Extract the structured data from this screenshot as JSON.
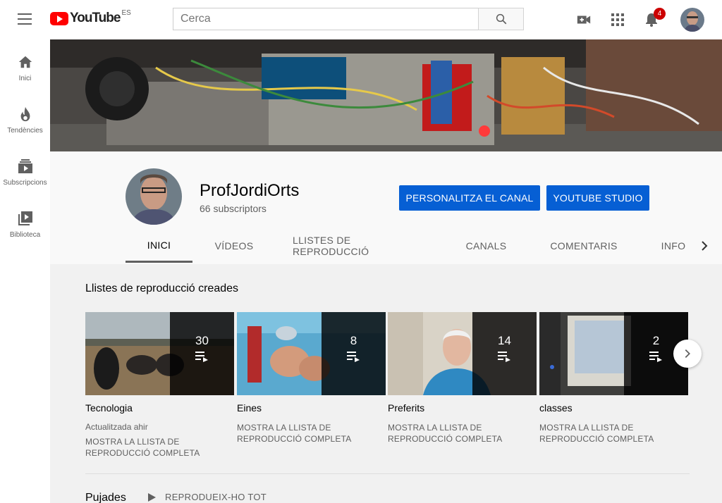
{
  "header": {
    "logo_text": "YouTube",
    "logo_region": "ES",
    "search_placeholder": "Cerca",
    "notification_count": "4"
  },
  "sidebar": {
    "items": [
      {
        "label": "Inici",
        "icon": "home-icon"
      },
      {
        "label": "Tendències",
        "icon": "trending-icon"
      },
      {
        "label": "Subscripcions",
        "icon": "subscriptions-icon"
      },
      {
        "label": "Biblioteca",
        "icon": "library-icon"
      }
    ]
  },
  "channel": {
    "name": "ProfJordiOrts",
    "subscribers": "66 subscriptors",
    "customize_label": "PERSONALITZA EL CANAL",
    "studio_label": "YOUTUBE STUDIO"
  },
  "tabs": [
    {
      "label": "INICI",
      "active": true
    },
    {
      "label": "VÍDEOS",
      "active": false
    },
    {
      "label": "LLISTES DE REPRODUCCIÓ",
      "active": false
    },
    {
      "label": "CANALS",
      "active": false
    },
    {
      "label": "COMENTARIS",
      "active": false
    },
    {
      "label": "INFO",
      "active": false
    }
  ],
  "playlists_section": {
    "title": "Llistes de reproducció creades",
    "items": [
      {
        "title": "Tecnologia",
        "count": "30",
        "meta": "Actualitzada ahir",
        "link": "MOSTRA LA LLISTA DE REPRODUCCIÓ COMPLETA"
      },
      {
        "title": "Eines",
        "count": "8",
        "meta": "",
        "link": "MOSTRA LA LLISTA DE REPRODUCCIÓ COMPLETA"
      },
      {
        "title": "Preferits",
        "count": "14",
        "meta": "",
        "link": "MOSTRA LA LLISTA DE REPRODUCCIÓ COMPLETA"
      },
      {
        "title": "classes",
        "count": "2",
        "meta": "",
        "link": "MOSTRA LA LLISTA DE REPRODUCCIÓ COMPLETA"
      }
    ]
  },
  "uploads_section": {
    "title": "Pujades",
    "play_all_label": "REPRODUEIX-HO TOT"
  },
  "colors": {
    "brand_red": "#ff0000",
    "button_blue": "#065fd4",
    "badge_red": "#cc0000"
  }
}
